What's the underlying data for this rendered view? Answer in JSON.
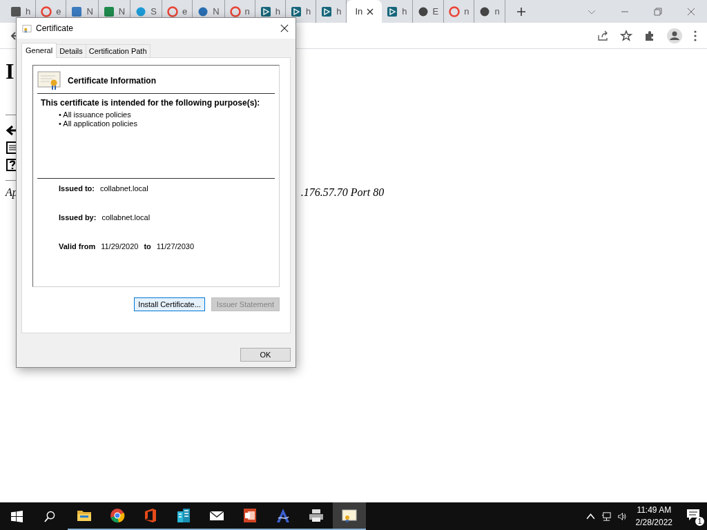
{
  "browser": {
    "tabs": [
      {
        "label": "h",
        "selected": false
      },
      {
        "label": "e",
        "selected": false
      },
      {
        "label": "N",
        "selected": false
      },
      {
        "label": "N",
        "selected": false
      },
      {
        "label": "S",
        "selected": false
      },
      {
        "label": "e",
        "selected": false
      },
      {
        "label": "N",
        "selected": false
      },
      {
        "label": "n",
        "selected": false
      },
      {
        "label": "h",
        "selected": false
      },
      {
        "label": "h",
        "selected": false
      },
      {
        "label": "h",
        "selected": false
      },
      {
        "label": "In",
        "selected": true
      },
      {
        "label": "h",
        "selected": false
      },
      {
        "label": "E",
        "selected": false
      },
      {
        "label": "n",
        "selected": false
      },
      {
        "label": "n",
        "selected": false
      }
    ]
  },
  "page": {
    "heading": "I",
    "address_start": "Ap",
    "address_end": ".176.57.70 Port 80"
  },
  "dialog": {
    "title": "Certificate",
    "tabs": [
      {
        "label": "General",
        "selected": true
      },
      {
        "label": "Details",
        "selected": false
      },
      {
        "label": "Certification Path",
        "selected": false
      }
    ],
    "info_title": "Certificate Information",
    "purpose_heading": "This certificate is intended for the following purpose(s):",
    "purposes": [
      "• All issuance policies",
      "• All application policies"
    ],
    "issued_to_label": "Issued to:",
    "issued_to": "collabnet.local",
    "issued_by_label": "Issued by:",
    "issued_by": "collabnet.local",
    "valid_from_label": "Valid from",
    "valid_from": "11/29/2020",
    "valid_to_label": "to",
    "valid_to": "11/27/2030",
    "buttons": [
      {
        "label": "Install Certificate...",
        "focused": true,
        "disabled": false
      },
      {
        "label": "Issuer Statement",
        "focused": false,
        "disabled": true
      }
    ],
    "ok": "OK"
  },
  "taskbar": {
    "apps": [
      {
        "running": true,
        "selected": false
      },
      {
        "running": true,
        "selected": false
      },
      {
        "running": true,
        "selected": false
      },
      {
        "running": true,
        "selected": false
      },
      {
        "running": true,
        "selected": false
      },
      {
        "running": true,
        "selected": false
      },
      {
        "running": true,
        "selected": false
      },
      {
        "running": true,
        "selected": false
      },
      {
        "running": true,
        "selected": true
      }
    ],
    "time": "11:49 AM",
    "date": "2/28/2022",
    "notifications": "1"
  }
}
